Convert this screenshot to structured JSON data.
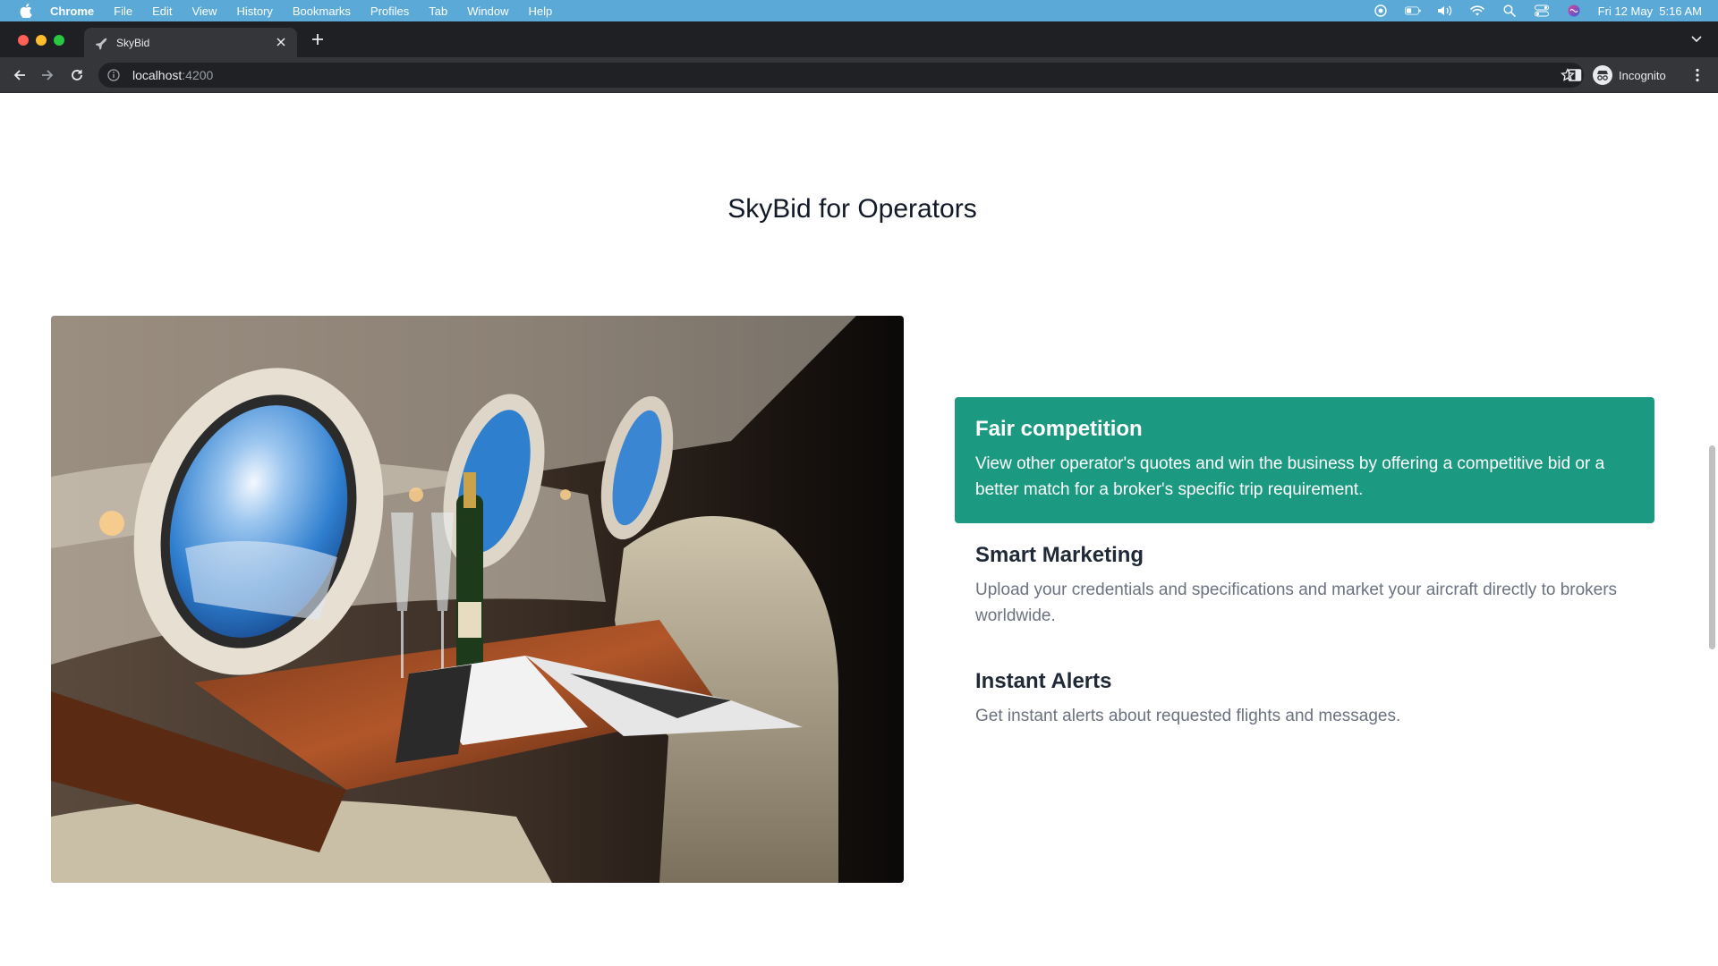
{
  "menubar": {
    "app": "Chrome",
    "items": [
      "File",
      "Edit",
      "View",
      "History",
      "Bookmarks",
      "Profiles",
      "Tab",
      "Window",
      "Help"
    ],
    "datetime": "Fri 12 May  5:16 AM"
  },
  "browser": {
    "tab_title": "SkyBid",
    "url_host": "localhost",
    "url_port": ":4200",
    "profile_label": "Incognito"
  },
  "page": {
    "section_title": "SkyBid for Operators",
    "features": [
      {
        "title": "Fair competition",
        "description": "View other operator's quotes and win the business by offering a competitive bid or a better match for a broker's specific trip requirement.",
        "active": true
      },
      {
        "title": "Smart Marketing",
        "description": "Upload your credentials and specifications and market your aircraft directly to brokers worldwide.",
        "active": false
      },
      {
        "title": "Instant Alerts",
        "description": "Get instant alerts about requested flights and messages.",
        "active": false
      }
    ]
  },
  "colors": {
    "accent": "#1c9a81",
    "heading": "#111827",
    "body_text": "#6b7280",
    "menubar": "#5aa9d6"
  }
}
